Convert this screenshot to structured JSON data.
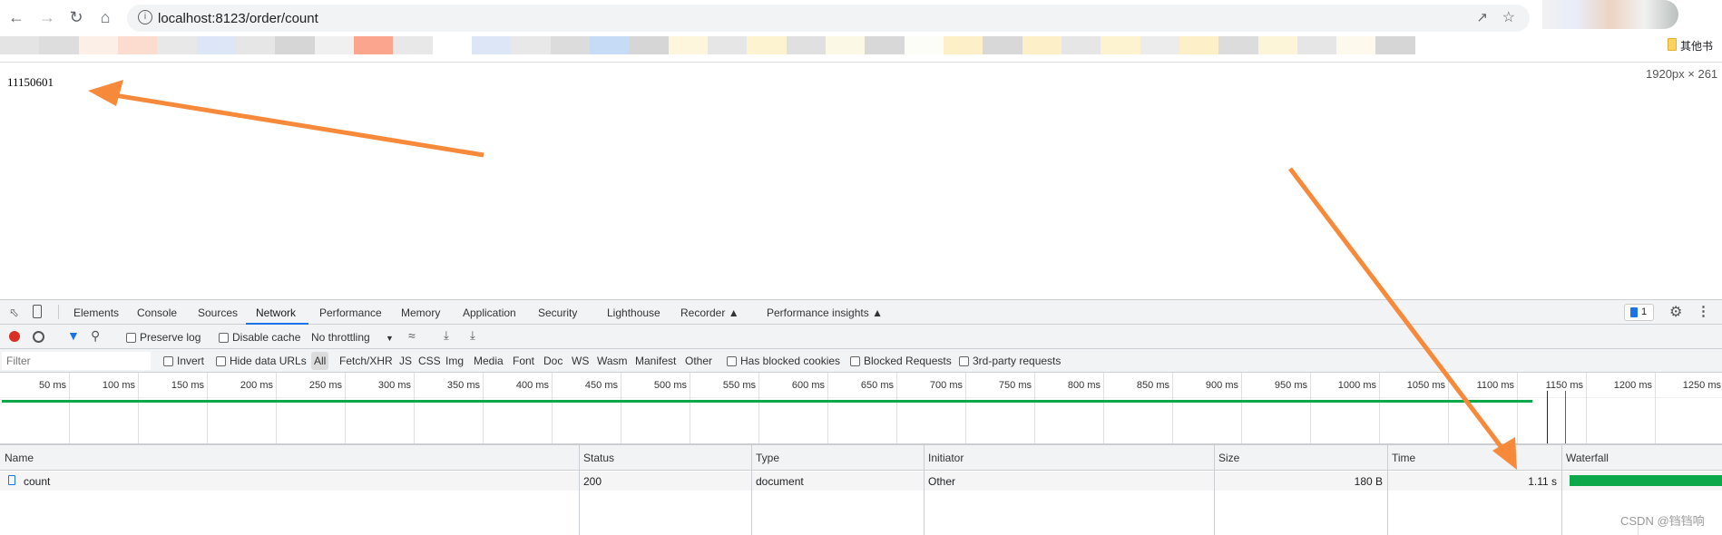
{
  "browser": {
    "url": "localhost:8123/order/count",
    "bookmark_folder": "其他书",
    "viewport_size": "1920px × 261"
  },
  "page": {
    "content": "11150601"
  },
  "devtools": {
    "tabs": [
      "Elements",
      "Console",
      "Sources",
      "Network",
      "Performance",
      "Memory",
      "Application",
      "Security",
      "Lighthouse",
      "Recorder",
      "Performance insights"
    ],
    "active_tab": "Network",
    "issues_count": "1",
    "toolbar": {
      "preserve_log": "Preserve log",
      "disable_cache": "Disable cache",
      "throttling": "No throttling"
    },
    "filter": {
      "placeholder": "Filter",
      "invert": "Invert",
      "hide_data_urls": "Hide data URLs",
      "types": [
        "All",
        "Fetch/XHR",
        "JS",
        "CSS",
        "Img",
        "Media",
        "Font",
        "Doc",
        "WS",
        "Wasm",
        "Manifest",
        "Other"
      ],
      "active_type": "All",
      "has_blocked_cookies": "Has blocked cookies",
      "blocked_requests": "Blocked Requests",
      "third_party": "3rd-party requests"
    },
    "timeline": {
      "ticks": [
        "50 ms",
        "100 ms",
        "150 ms",
        "200 ms",
        "250 ms",
        "300 ms",
        "350 ms",
        "400 ms",
        "450 ms",
        "500 ms",
        "550 ms",
        "600 ms",
        "650 ms",
        "700 ms",
        "750 ms",
        "800 ms",
        "850 ms",
        "900 ms",
        "950 ms",
        "1000 ms",
        "1050 ms",
        "1100 ms",
        "1150 ms",
        "1200 ms",
        "1250 ms"
      ],
      "request_end_ms": 1110,
      "dom_content_loaded_ms": 1122,
      "load_ms": 1135
    },
    "table": {
      "columns": [
        "Name",
        "Status",
        "Type",
        "Initiator",
        "Size",
        "Time",
        "Waterfall"
      ],
      "rows": [
        {
          "name": "count",
          "status": "200",
          "type": "document",
          "initiator": "Other",
          "size": "180 B",
          "time": "1.11 s"
        }
      ]
    }
  },
  "watermark": "CSDN @铛铛响",
  "colors": {
    "accent": "#1a73e8",
    "record": "#d93025",
    "waterfall": "#0ca84a",
    "annotation": "#f7893b"
  }
}
